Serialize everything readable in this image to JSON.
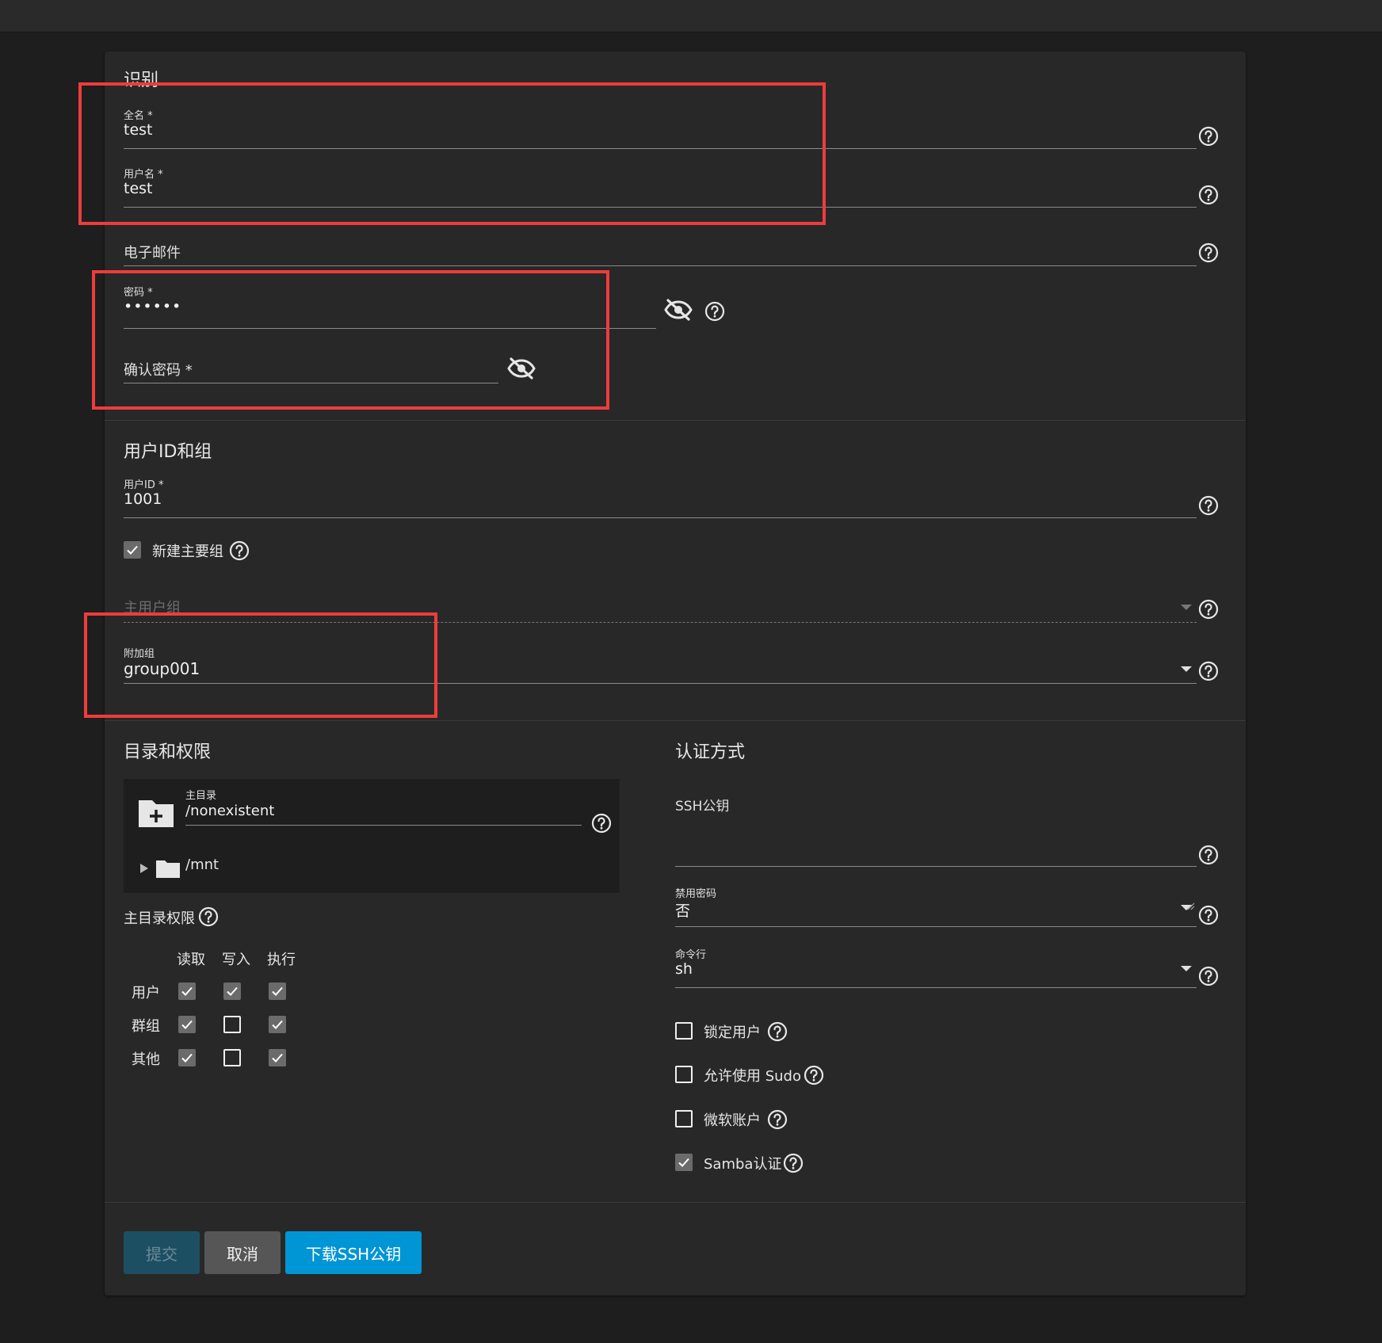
{
  "identification": {
    "title": "识别",
    "full_name": {
      "label": "全名 *",
      "value": "test"
    },
    "username": {
      "label": "用户名 *",
      "value": "test"
    },
    "email": {
      "placeholder": "电子邮件"
    },
    "password": {
      "label": "密码 *",
      "value": "••••••"
    },
    "confirm_password": {
      "placeholder": "确认密码 *"
    }
  },
  "uid_group": {
    "title": "用户ID和组",
    "uid": {
      "label": "用户ID *",
      "value": "1001"
    },
    "new_primary_group": {
      "label": "新建主要组",
      "checked": true
    },
    "primary_group": {
      "placeholder": "主用户组"
    },
    "aux_groups": {
      "label": "附加组",
      "value": "group001"
    }
  },
  "directory": {
    "title": "目录和权限",
    "home_label": "主目录",
    "home_value": "/nonexistent",
    "tree_item": "/mnt",
    "perm_title": "主目录权限",
    "perm_cols": [
      "读取",
      "写入",
      "执行"
    ],
    "perm_rows": [
      {
        "name": "用户",
        "read": true,
        "write": true,
        "exec": true
      },
      {
        "name": "群组",
        "read": true,
        "write": false,
        "exec": true
      },
      {
        "name": "其他",
        "read": true,
        "write": false,
        "exec": true
      }
    ]
  },
  "auth": {
    "title": "认证方式",
    "ssh_key": {
      "placeholder": "SSH公钥"
    },
    "disable_password": {
      "label": "禁用密码",
      "value": "否"
    },
    "shell": {
      "label": "命令行",
      "value": "sh"
    },
    "lock_user": {
      "label": "锁定用户",
      "checked": false
    },
    "sudo": {
      "label": "允许使用 Sudo",
      "checked": false
    },
    "microsoft": {
      "label": "微软账户",
      "checked": false
    },
    "samba": {
      "label": "Samba认证",
      "checked": true
    }
  },
  "buttons": {
    "submit": "提交",
    "cancel": "取消",
    "download": "下载SSH公钥"
  },
  "colors": {
    "submit_bg": "#1d4f63",
    "cancel_bg": "#565656",
    "download_bg": "#0095d5",
    "highlight": "#ee3c3c"
  }
}
